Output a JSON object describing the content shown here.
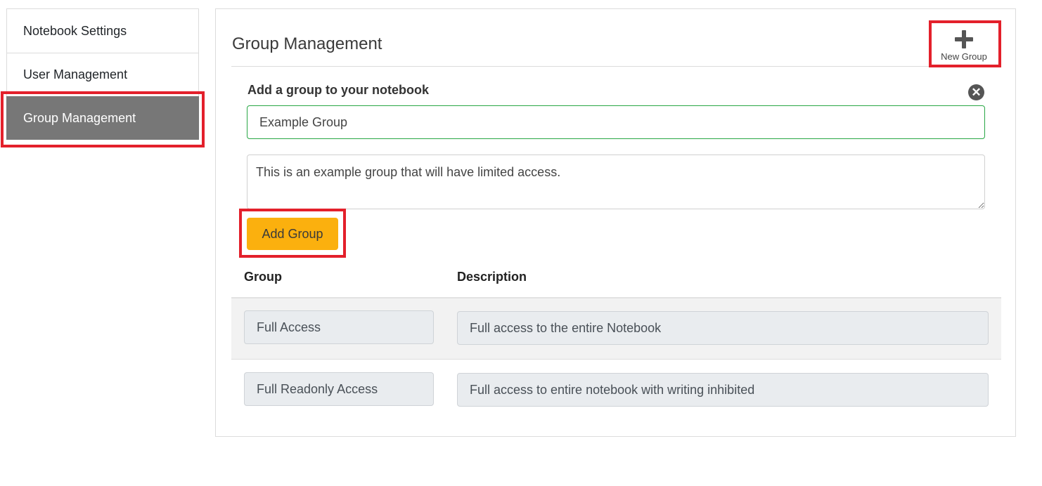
{
  "sidebar": {
    "items": [
      {
        "label": "Notebook Settings",
        "active": false
      },
      {
        "label": "User Management",
        "active": false
      },
      {
        "label": "Group Management",
        "active": true
      }
    ]
  },
  "panel": {
    "title": "Group Management",
    "new_group_label": "New Group",
    "new_group_icon": "plus-icon",
    "close_icon": "close-circle-icon",
    "form": {
      "title": "Add a group to your notebook",
      "name_value": "Example Group",
      "description_value": "This is an example group that will have limited access.",
      "submit_label": "Add Group"
    },
    "table": {
      "headers": [
        "Group",
        "Description"
      ],
      "rows": [
        {
          "group": "Full Access",
          "description": "Full access to the entire Notebook"
        },
        {
          "group": "Full Readonly Access",
          "description": "Full access to entire notebook with writing inhibited"
        }
      ]
    }
  },
  "colors": {
    "highlight": "#e3202b",
    "active_sidebar": "#777777",
    "add_button": "#fbb00e",
    "input_valid_border": "#28a745"
  }
}
